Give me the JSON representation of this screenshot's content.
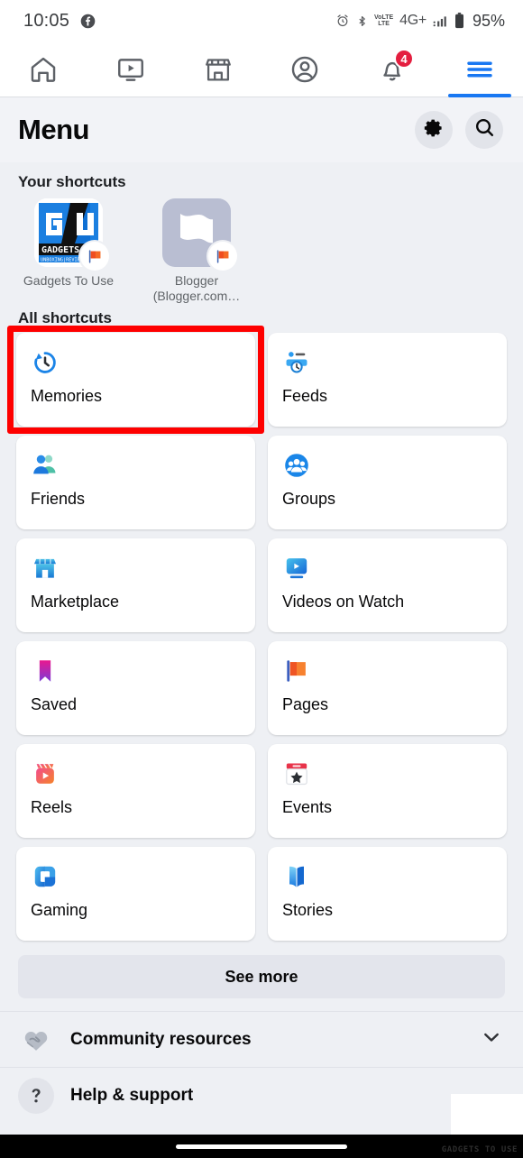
{
  "status_bar": {
    "time": "10:05",
    "app_notification_icon": "facebook-icon",
    "icons": [
      "alarm-icon",
      "bluetooth-icon",
      "volte-icon",
      "signal-icon"
    ],
    "volte_top": "VoLTE",
    "volte_bottom": "LTE",
    "network": "4G+",
    "battery_percent": "95%"
  },
  "top_nav": {
    "tabs": [
      {
        "name": "home",
        "icon": "home-icon",
        "active": false,
        "badge": ""
      },
      {
        "name": "video",
        "icon": "video-icon",
        "active": false,
        "badge": ""
      },
      {
        "name": "marketplace",
        "icon": "store-icon",
        "active": false,
        "badge": ""
      },
      {
        "name": "profile",
        "icon": "account-circle-icon",
        "active": false,
        "badge": ""
      },
      {
        "name": "notifications",
        "icon": "bell-icon",
        "active": false,
        "badge": "4"
      },
      {
        "name": "menu",
        "icon": "hamburger-icon",
        "active": true,
        "badge": ""
      }
    ],
    "accent_color": "#1877f2"
  },
  "header": {
    "title": "Menu",
    "settings_icon": "gear-icon",
    "search_icon": "search-icon"
  },
  "your_shortcuts": {
    "label": "Your shortcuts",
    "items": [
      {
        "name": "Gadgets To Use",
        "thumb": "gadgets-to-use-logo",
        "badge_icon": "page-flag-icon"
      },
      {
        "name": "Blogger (Blogger.com…",
        "thumb": "blogger-flag-thumb",
        "badge_icon": "page-flag-icon"
      }
    ]
  },
  "all_shortcuts": {
    "label": "All shortcuts",
    "highlighted": "Memories",
    "highlight_color": "#fe0000",
    "tiles": [
      {
        "label": "Memories",
        "icon": "memories-clock-icon"
      },
      {
        "label": "Feeds",
        "icon": "feeds-icon"
      },
      {
        "label": "Friends",
        "icon": "friends-icon"
      },
      {
        "label": "Groups",
        "icon": "groups-icon"
      },
      {
        "label": "Marketplace",
        "icon": "marketplace-store-icon"
      },
      {
        "label": "Videos on Watch",
        "icon": "watch-video-icon"
      },
      {
        "label": "Saved",
        "icon": "saved-bookmark-icon"
      },
      {
        "label": "Pages",
        "icon": "pages-flag-icon"
      },
      {
        "label": "Reels",
        "icon": "reels-icon"
      },
      {
        "label": "Events",
        "icon": "events-calendar-icon"
      },
      {
        "label": "Gaming",
        "icon": "gaming-controller-icon"
      },
      {
        "label": "Stories",
        "icon": "stories-book-icon"
      }
    ]
  },
  "see_more": {
    "label": "See more"
  },
  "bottom_rows": [
    {
      "label": "Community resources",
      "icon": "handshake-heart-icon",
      "chevron": "chevron-down-icon"
    },
    {
      "label": "Help & support",
      "icon": "question-mark-icon",
      "chevron": ""
    }
  ],
  "watermark": {
    "text": "GADGETS TO USE"
  }
}
